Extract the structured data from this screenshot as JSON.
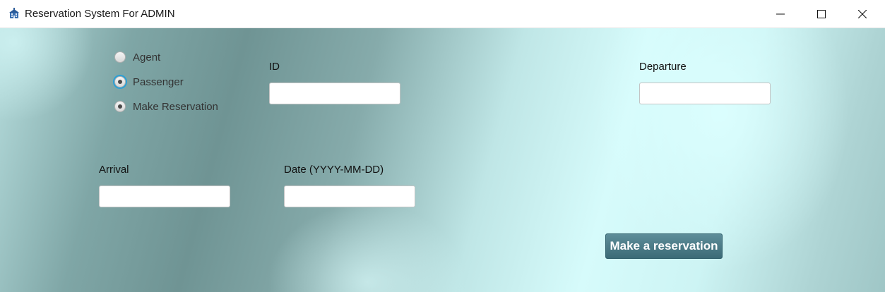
{
  "window": {
    "title": "Reservation System For ADMIN",
    "app_icon": "building-icon",
    "controls": {
      "minimize_icon": "minimize-icon",
      "maximize_icon": "maximize-icon",
      "close_icon": "close-icon"
    }
  },
  "options": [
    {
      "label": "Agent",
      "checked": false
    },
    {
      "label": "Passenger",
      "checked": true
    },
    {
      "label": "Make Reservation",
      "checked": true
    }
  ],
  "fields": {
    "id": {
      "label": "ID",
      "value": ""
    },
    "departure": {
      "label": "Departure",
      "value": ""
    },
    "arrival": {
      "label": "Arrival",
      "value": ""
    },
    "date": {
      "label": "Date (YYYY-MM-DD)",
      "value": ""
    }
  },
  "actions": {
    "reserve_label": "Make a reservation"
  },
  "colors": {
    "button": "#4a7884",
    "focus_ring": "#2a9fd6"
  }
}
